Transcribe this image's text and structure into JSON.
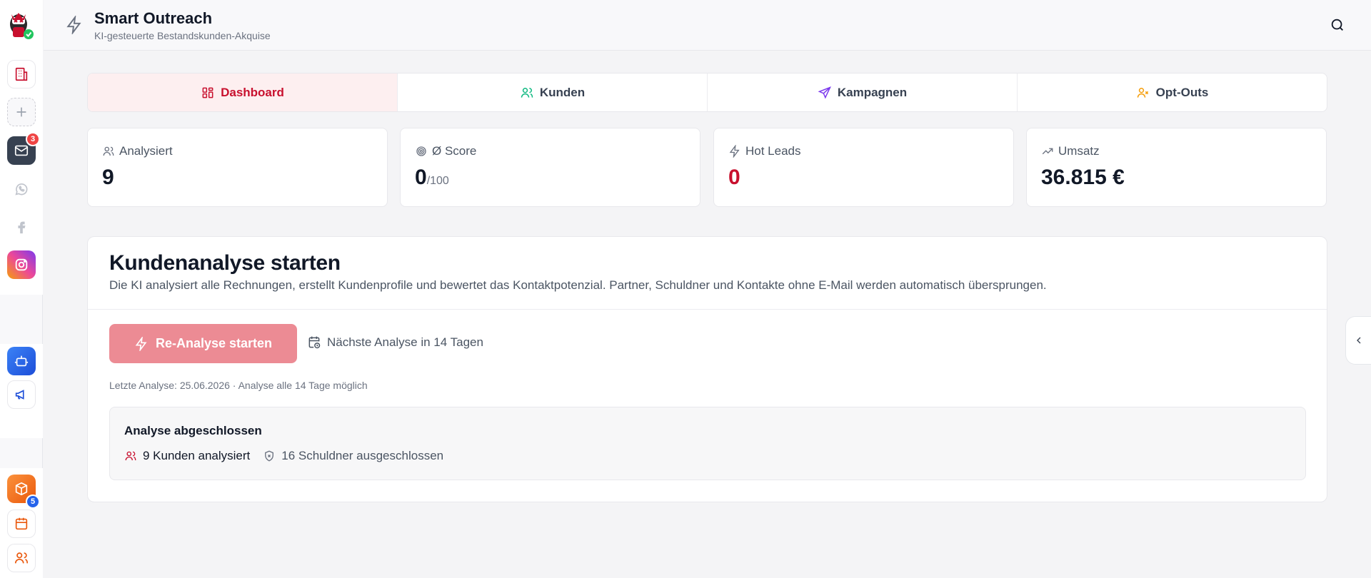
{
  "header": {
    "title": "Smart Outreach",
    "subtitle": "KI-gesteuerte Bestandskunden-Akquise"
  },
  "rail": {
    "mail_badge": "3",
    "orders_badge": "5"
  },
  "tabs": [
    {
      "label": "Dashboard",
      "icon": "grid-icon",
      "color": "#c8102e"
    },
    {
      "label": "Kunden",
      "icon": "users-icon",
      "color": "#10b981"
    },
    {
      "label": "Kampagnen",
      "icon": "send-icon",
      "color": "#7c3aed"
    },
    {
      "label": "Opt-Outs",
      "icon": "user-x-icon",
      "color": "#f59e0b"
    }
  ],
  "stats": [
    {
      "label": "Analysiert",
      "value": "9",
      "unit": "",
      "icon": "users-icon"
    },
    {
      "label": "Ø Score",
      "value": "0",
      "unit": "/100",
      "icon": "target-icon"
    },
    {
      "label": "Hot Leads",
      "value": "0",
      "unit": "",
      "icon": "bolt-icon",
      "value_color": "#c8102e"
    },
    {
      "label": "Umsatz",
      "value": "36.815 €",
      "unit": "",
      "icon": "trending-up-icon"
    }
  ],
  "analysis": {
    "title": "Kundenanalyse starten",
    "description": "Die KI analysiert alle Rechnungen, erstellt Kundenprofile und bewertet das Kontaktpotenzial. Partner, Schuldner und Kontakte ohne E-Mail werden automatisch übersprungen.",
    "button_label": "Re-Analyse starten",
    "next_label": "Nächste Analyse in 14 Tagen",
    "meta": "Letzte Analyse: 25.06.2026 · Analyse alle 14 Tage möglich",
    "result": {
      "title": "Analyse abgeschlossen",
      "customers": "9 Kunden analysiert",
      "debtors": "16 Schuldner ausgeschlossen"
    }
  },
  "colors": {
    "accent": "#c8102e",
    "button_disabled": "#ec8b94"
  }
}
